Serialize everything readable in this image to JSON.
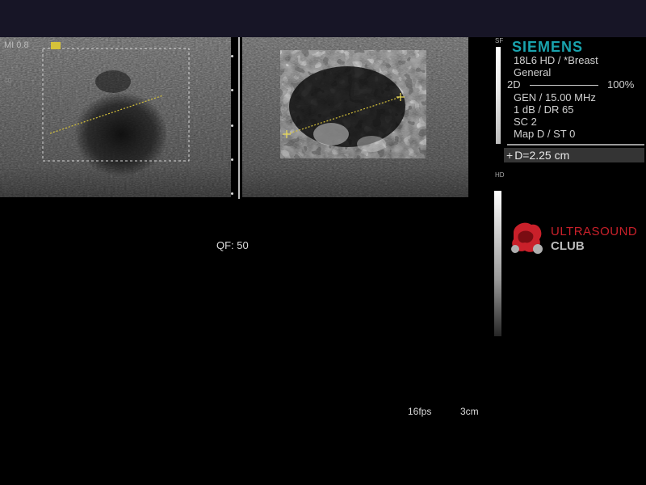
{
  "header": {
    "mi_label": "MI  0.8"
  },
  "left_image": {
    "side_label": "R"
  },
  "footer": {
    "qf": "QF: 50",
    "fps": "16fps",
    "depth": "3cm"
  },
  "side_panel": {
    "sf_label": "SF",
    "hd_label": "HD",
    "brand": "SIEMENS",
    "transducer": "18L6 HD / *Breast",
    "preset": "General",
    "mode": "2D",
    "gain_percent": "100%",
    "frequency": "GEN / 15.00 MHz",
    "db_dr": "1 dB / DR 65",
    "sc": "SC 2",
    "map": "Map D / ST 0",
    "measurement": "D=2.25 cm",
    "measurement_icon": "crosshair-icon"
  },
  "watermark": {
    "line1": "ULTRASOUND",
    "line2": "CLUB",
    "colors": {
      "red": "#c9202a",
      "gray": "#b9b9b9"
    }
  },
  "colors": {
    "brand": "#19a3ad",
    "topbar": "#171526",
    "caliper": "#d6c23a"
  }
}
